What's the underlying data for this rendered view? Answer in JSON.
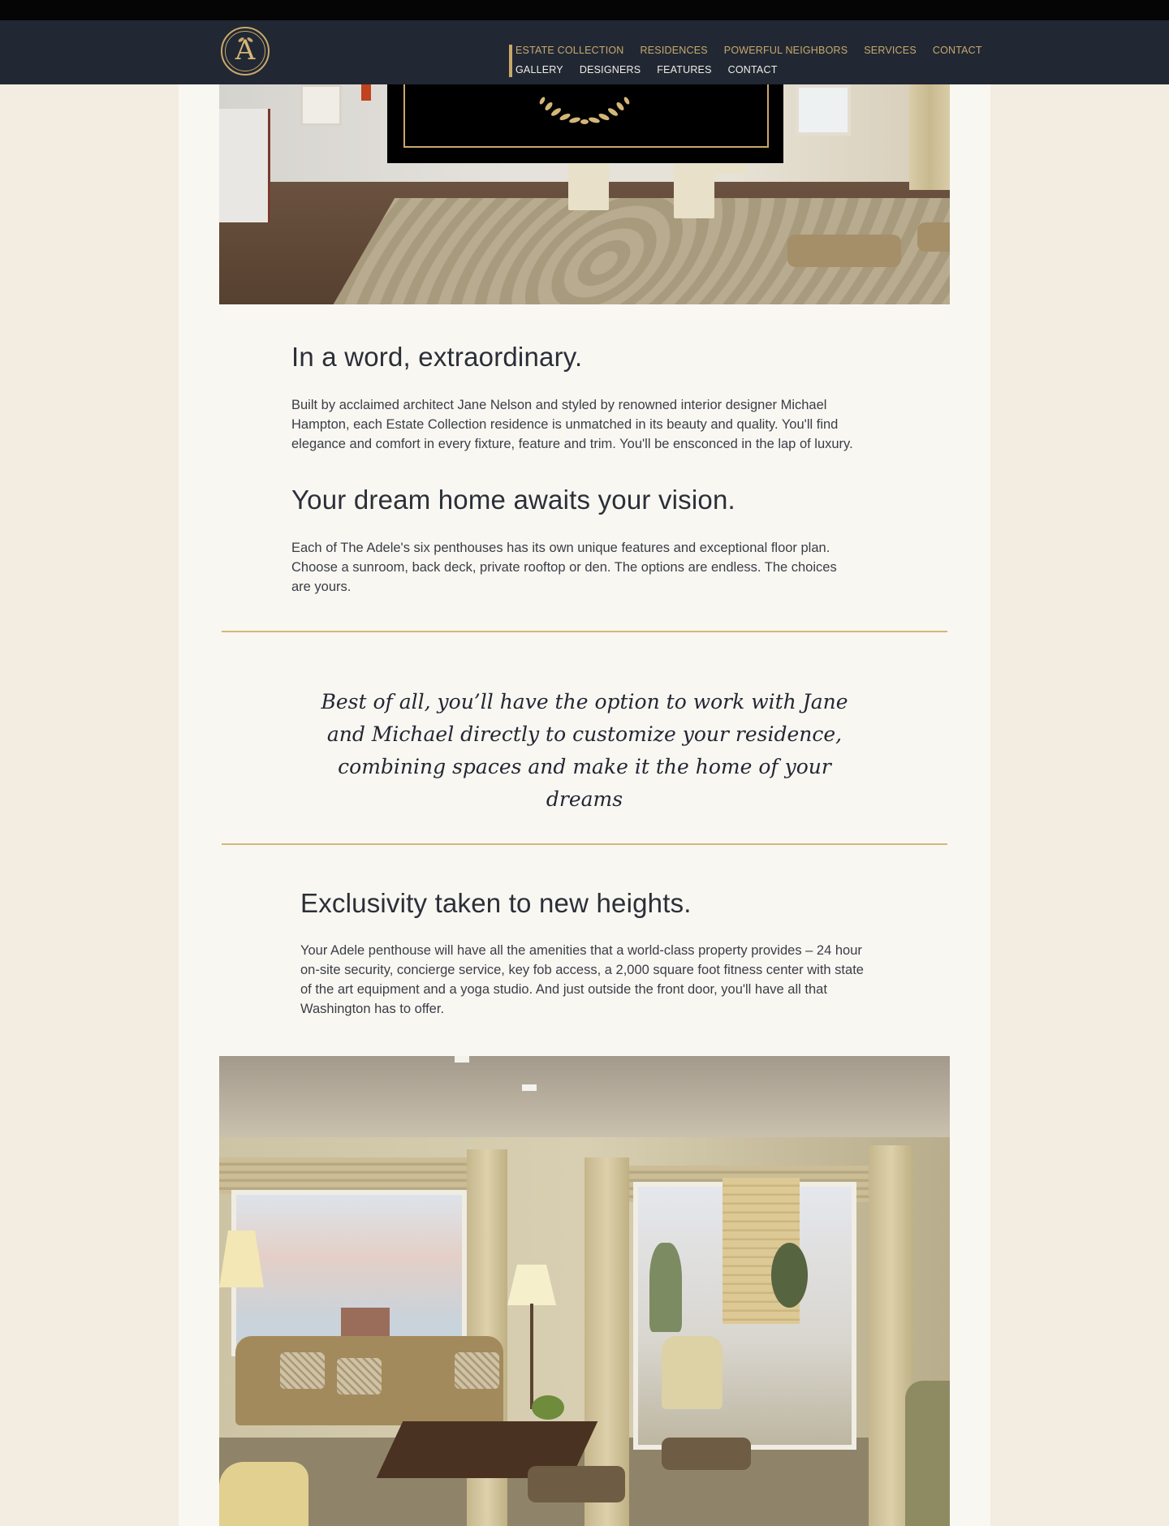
{
  "nav": {
    "primary": [
      "ESTATE COLLECTION",
      "RESIDENCES",
      "POWERFUL NEIGHBORS",
      "SERVICES",
      "CONTACT"
    ],
    "secondary": [
      "GALLERY",
      "DESIGNERS",
      "FEATURES",
      "CONTACT"
    ]
  },
  "logo": {
    "letter": "A"
  },
  "sections": {
    "s1": {
      "heading": "In a word, extraordinary.",
      "body": "Built by acclaimed architect Jane Nelson and styled by renowned interior designer Michael Hampton, each Estate Collection residence is unmatched in its beauty and quality. You'll find elegance and comfort in every fixture, feature and trim. You'll be ensconced in the lap of luxury."
    },
    "s2": {
      "heading": "Your dream home awaits your vision.",
      "body": "Each of The Adele's six penthouses has its own unique features and exceptional floor plan. Choose a sunroom, back deck, private rooftop or den. The options are endless. The choices are yours."
    },
    "quote": "Best of all, you’ll have the option to work with Jane and Michael directly to customize your residence, combining spaces and make it the home of your dreams",
    "s3": {
      "heading": "Exclusivity taken to new heights.",
      "body": "Your Adele penthouse will have all the amenities that a world-class property provides – 24 hour on-site security, concierge service, key fob access, a 2,000 square foot fitness center with state of the art equipment and a yoga studio. And just outside the front door, you'll have all that Washington has to offer."
    }
  },
  "colors": {
    "header_bg": "#212834",
    "accent_gold": "#c9a86a",
    "page_bg": "#f3ece0",
    "content_bg": "#f9f7f2"
  }
}
